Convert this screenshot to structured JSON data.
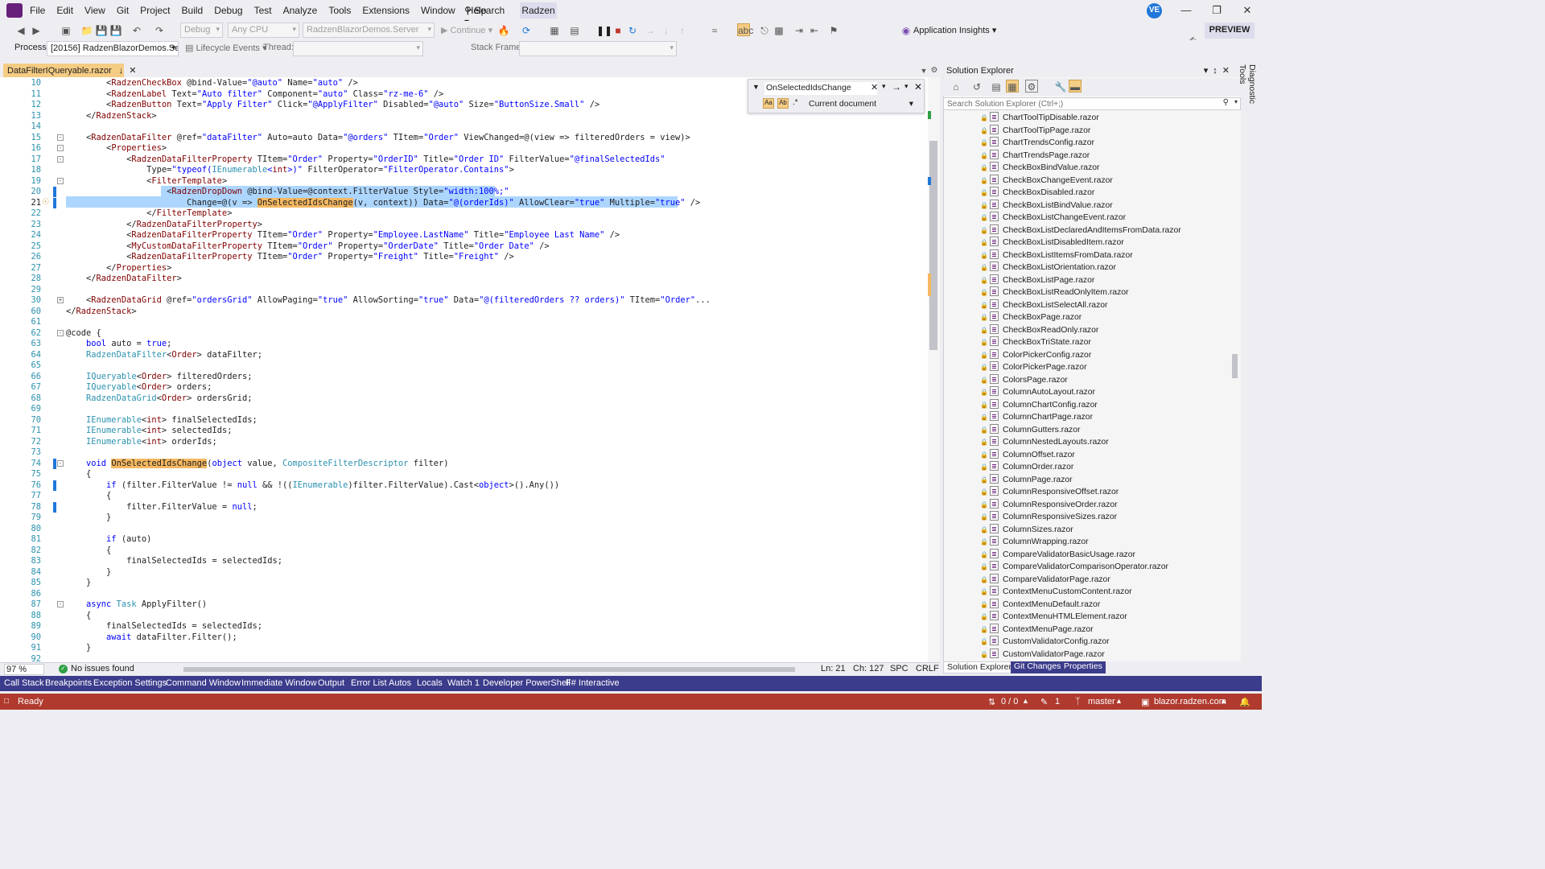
{
  "menubar": {
    "items": [
      "File",
      "Edit",
      "View",
      "Git",
      "Project",
      "Build",
      "Debug",
      "Test",
      "Analyze",
      "Tools",
      "Extensions",
      "Window",
      "Help"
    ],
    "search_label": "Search",
    "radzen_label": "Radzen",
    "avatar_initials": "VE"
  },
  "toolbar": {
    "config_combo": "Debug",
    "platform_combo": "Any CPU",
    "project_combo": "RadzenBlazorDemos.Server",
    "continue_label": "Continue",
    "app_insights_label": "Application Insights",
    "preview_label": "PREVIEW",
    "process_label": "Process:",
    "process_value": "[20156] RadzenBlazorDemos.Serve",
    "lifecycle_label": "Lifecycle Events",
    "thread_label": "Thread:",
    "stack_frame_label": "Stack Frame:"
  },
  "editor": {
    "tab_title": "DataFilterIQueryable.razor",
    "zoom": "97 %",
    "issues": "No issues found",
    "position": {
      "line": "Ln: 21",
      "col": "Ch: 127",
      "spc": "SPC",
      "eol": "CRLF"
    },
    "find": {
      "query": "OnSelectedIdsChange",
      "scope": "Current document"
    },
    "lines": [
      {
        "n": "10",
        "t": "        <RadzenCheckBox @bind-Value=\"@auto\" Name=\"auto\" />"
      },
      {
        "n": "11",
        "t": "        <RadzenLabel Text=\"Auto filter\" Component=\"auto\" Class=\"rz-me-6\" />"
      },
      {
        "n": "12",
        "t": "        <RadzenButton Text=\"Apply Filter\" Click=\"@ApplyFilter\" Disabled=\"@auto\" Size=\"ButtonSize.Small\" />"
      },
      {
        "n": "13",
        "t": "    </RadzenStack>"
      },
      {
        "n": "14",
        "t": ""
      },
      {
        "n": "15",
        "t": "    <RadzenDataFilter @ref=\"dataFilter\" Auto=auto Data=\"@orders\" TItem=\"Order\" ViewChanged=@(view => filteredOrders = view)>"
      },
      {
        "n": "16",
        "t": "        <Properties>"
      },
      {
        "n": "17",
        "t": "            <RadzenDataFilterProperty TItem=\"Order\" Property=\"OrderID\" Title=\"Order ID\" FilterValue=\"@finalSelectedIds\""
      },
      {
        "n": "18",
        "t": "                Type=\"typeof(IEnumerable<int>)\" FilterOperator=\"FilterOperator.Contains\">"
      },
      {
        "n": "19",
        "t": "                <FilterTemplate>"
      },
      {
        "n": "20",
        "t": "                    <RadzenDropDown @bind-Value=@context.FilterValue Style=\"width:100%;\""
      },
      {
        "n": "21",
        "t": "                        Change=@(v => OnSelectedIdsChange(v, context)) Data=\"@(orderIds)\" AllowClear=\"true\" Multiple=\"true\" />"
      },
      {
        "n": "22",
        "t": "                </FilterTemplate>"
      },
      {
        "n": "23",
        "t": "            </RadzenDataFilterProperty>"
      },
      {
        "n": "24",
        "t": "            <RadzenDataFilterProperty TItem=\"Order\" Property=\"Employee.LastName\" Title=\"Employee Last Name\" />"
      },
      {
        "n": "25",
        "t": "            <MyCustomDataFilterProperty TItem=\"Order\" Property=\"OrderDate\" Title=\"Order Date\" />"
      },
      {
        "n": "26",
        "t": "            <RadzenDataFilterProperty TItem=\"Order\" Property=\"Freight\" Title=\"Freight\" />"
      },
      {
        "n": "27",
        "t": "        </Properties>"
      },
      {
        "n": "28",
        "t": "    </RadzenDataFilter>"
      },
      {
        "n": "29",
        "t": ""
      },
      {
        "n": "30",
        "t": "    <RadzenDataGrid @ref=\"ordersGrid\" AllowPaging=\"true\" AllowSorting=\"true\" Data=\"@(filteredOrders ?? orders)\" TItem=\"Order\"..."
      },
      {
        "n": "60",
        "t": "</RadzenStack>"
      },
      {
        "n": "61",
        "t": ""
      },
      {
        "n": "62",
        "t": "@code {"
      },
      {
        "n": "63",
        "t": "    bool auto = true;"
      },
      {
        "n": "64",
        "t": "    RadzenDataFilter<Order> dataFilter;"
      },
      {
        "n": "65",
        "t": ""
      },
      {
        "n": "66",
        "t": "    IQueryable<Order> filteredOrders;"
      },
      {
        "n": "67",
        "t": "    IQueryable<Order> orders;"
      },
      {
        "n": "68",
        "t": "    RadzenDataGrid<Order> ordersGrid;"
      },
      {
        "n": "69",
        "t": ""
      },
      {
        "n": "70",
        "t": "    IEnumerable<int> finalSelectedIds;"
      },
      {
        "n": "71",
        "t": "    IEnumerable<int> selectedIds;"
      },
      {
        "n": "72",
        "t": "    IEnumerable<int> orderIds;"
      },
      {
        "n": "73",
        "t": ""
      },
      {
        "n": "74",
        "t": "    void OnSelectedIdsChange(object value, CompositeFilterDescriptor filter)"
      },
      {
        "n": "75",
        "t": "    {"
      },
      {
        "n": "76",
        "t": "        if (filter.FilterValue != null && !((IEnumerable)filter.FilterValue).Cast<object>().Any())"
      },
      {
        "n": "77",
        "t": "        {"
      },
      {
        "n": "78",
        "t": "            filter.FilterValue = null;"
      },
      {
        "n": "79",
        "t": "        }"
      },
      {
        "n": "80",
        "t": ""
      },
      {
        "n": "81",
        "t": "        if (auto)"
      },
      {
        "n": "82",
        "t": "        {"
      },
      {
        "n": "83",
        "t": "            finalSelectedIds = selectedIds;"
      },
      {
        "n": "84",
        "t": "        }"
      },
      {
        "n": "85",
        "t": "    }"
      },
      {
        "n": "86",
        "t": ""
      },
      {
        "n": "87",
        "t": "    async Task ApplyFilter()"
      },
      {
        "n": "88",
        "t": "    {"
      },
      {
        "n": "89",
        "t": "        finalSelectedIds = selectedIds;"
      },
      {
        "n": "90",
        "t": "        await dataFilter.Filter();"
      },
      {
        "n": "91",
        "t": "    }"
      },
      {
        "n": "92",
        "t": ""
      }
    ]
  },
  "solution_explorer": {
    "title": "Solution Explorer",
    "search_placeholder": "Search Solution Explorer (Ctrl+;)",
    "files": [
      "ChartToolTipDisable.razor",
      "ChartToolTipPage.razor",
      "ChartTrendsConfig.razor",
      "ChartTrendsPage.razor",
      "CheckBoxBindValue.razor",
      "CheckBoxChangeEvent.razor",
      "CheckBoxDisabled.razor",
      "CheckBoxListBindValue.razor",
      "CheckBoxListChangeEvent.razor",
      "CheckBoxListDeclaredAndItemsFromData.razor",
      "CheckBoxListDisabledItem.razor",
      "CheckBoxListItemsFromData.razor",
      "CheckBoxListOrientation.razor",
      "CheckBoxListPage.razor",
      "CheckBoxListReadOnlyItem.razor",
      "CheckBoxListSelectAll.razor",
      "CheckBoxPage.razor",
      "CheckBoxReadOnly.razor",
      "CheckBoxTriState.razor",
      "ColorPickerConfig.razor",
      "ColorPickerPage.razor",
      "ColorsPage.razor",
      "ColumnAutoLayout.razor",
      "ColumnChartConfig.razor",
      "ColumnChartPage.razor",
      "ColumnGutters.razor",
      "ColumnNestedLayouts.razor",
      "ColumnOffset.razor",
      "ColumnOrder.razor",
      "ColumnPage.razor",
      "ColumnResponsiveOffset.razor",
      "ColumnResponsiveOrder.razor",
      "ColumnResponsiveSizes.razor",
      "ColumnSizes.razor",
      "ColumnWrapping.razor",
      "CompareValidatorBasicUsage.razor",
      "CompareValidatorComparisonOperator.razor",
      "CompareValidatorPage.razor",
      "ContextMenuCustomContent.razor",
      "ContextMenuDefault.razor",
      "ContextMenuHTMLElement.razor",
      "ContextMenuPage.razor",
      "CustomValidatorConfig.razor",
      "CustomValidatorPage.razor"
    ],
    "tabs": [
      "Solution Explorer",
      "Git Changes",
      "Properties"
    ]
  },
  "diagnostic_tools_label": "Diagnostic Tools",
  "tool_tabs": [
    "Call Stack",
    "Breakpoints",
    "Exception Settings",
    "Command Window",
    "Immediate Window",
    "Output",
    "Error List",
    "Autos",
    "Locals",
    "Watch 1",
    "Developer PowerShell",
    "F# Interactive"
  ],
  "status": {
    "ready": "Ready",
    "sync": "0 / 0",
    "edits": "1",
    "branch": "master",
    "repo": "blazor.radzen.com"
  }
}
